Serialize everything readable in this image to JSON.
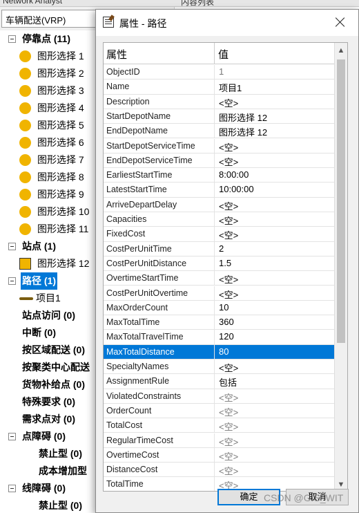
{
  "app": {
    "top_tab_left": "Network Analyst",
    "top_tab_right": "内容列表",
    "analysis_layer": "车辆配送(VRP)"
  },
  "tree": [
    {
      "label": "停靠点 (11)",
      "kind": "group",
      "bold": true
    },
    {
      "label": "图形选择 1",
      "kind": "stop"
    },
    {
      "label": "图形选择 2",
      "kind": "stop"
    },
    {
      "label": "图形选择 3",
      "kind": "stop"
    },
    {
      "label": "图形选择 4",
      "kind": "stop"
    },
    {
      "label": "图形选择 5",
      "kind": "stop"
    },
    {
      "label": "图形选择 6",
      "kind": "stop"
    },
    {
      "label": "图形选择 7",
      "kind": "stop"
    },
    {
      "label": "图形选择 8",
      "kind": "stop"
    },
    {
      "label": "图形选择 9",
      "kind": "stop"
    },
    {
      "label": "图形选择 10",
      "kind": "stop"
    },
    {
      "label": "图形选择 11",
      "kind": "stop"
    },
    {
      "label": "站点 (1)",
      "kind": "group",
      "bold": true
    },
    {
      "label": "图形选择 12",
      "kind": "depot"
    },
    {
      "label": "路径 (1)",
      "kind": "group",
      "bold": true,
      "selected": true
    },
    {
      "label": "项目1",
      "kind": "route"
    },
    {
      "label": "站点访问 (0)",
      "kind": "leaf",
      "bold": true
    },
    {
      "label": "中断 (0)",
      "kind": "leaf",
      "bold": true
    },
    {
      "label": "按区域配送 (0)",
      "kind": "leaf",
      "bold": true
    },
    {
      "label": "按聚类中心配送",
      "kind": "leaf",
      "bold": true
    },
    {
      "label": "货物补给点 (0)",
      "kind": "leaf",
      "bold": true
    },
    {
      "label": "特殊要求 (0)",
      "kind": "leaf",
      "bold": true
    },
    {
      "label": "需求点对 (0)",
      "kind": "leaf",
      "bold": true
    },
    {
      "label": "点障碍 (0)",
      "kind": "group",
      "bold": true
    },
    {
      "label": "禁止型 (0)",
      "kind": "subleaf",
      "bold": true
    },
    {
      "label": "成本增加型",
      "kind": "subleaf",
      "bold": true
    },
    {
      "label": "线障碍 (0)",
      "kind": "group",
      "bold": true
    },
    {
      "label": "禁止型 (0)",
      "kind": "subleaf",
      "bold": true
    }
  ],
  "dialog": {
    "title": "属性 - 路径",
    "header_property": "属性",
    "header_value": "值",
    "rows": [
      {
        "k": "ObjectID",
        "v": "1",
        "dim": true
      },
      {
        "k": "Name",
        "v": "项目1"
      },
      {
        "k": "Description",
        "v": "<空>"
      },
      {
        "k": "StartDepotName",
        "v": "图形选择 12"
      },
      {
        "k": "EndDepotName",
        "v": "图形选择 12"
      },
      {
        "k": "StartDepotServiceTime",
        "v": "<空>"
      },
      {
        "k": "EndDepotServiceTime",
        "v": "<空>"
      },
      {
        "k": "EarliestStartTime",
        "v": "8:00:00"
      },
      {
        "k": "LatestStartTime",
        "v": "10:00:00"
      },
      {
        "k": "ArriveDepartDelay",
        "v": "<空>"
      },
      {
        "k": "Capacities",
        "v": "<空>"
      },
      {
        "k": "FixedCost",
        "v": "<空>"
      },
      {
        "k": "CostPerUnitTime",
        "v": "2"
      },
      {
        "k": "CostPerUnitDistance",
        "v": "1.5"
      },
      {
        "k": "OvertimeStartTime",
        "v": "<空>"
      },
      {
        "k": "CostPerUnitOvertime",
        "v": "<空>"
      },
      {
        "k": "MaxOrderCount",
        "v": "10"
      },
      {
        "k": "MaxTotalTime",
        "v": "360"
      },
      {
        "k": "MaxTotalTravelTime",
        "v": "120"
      },
      {
        "k": "MaxTotalDistance",
        "v": "80",
        "selected": true
      },
      {
        "k": "SpecialtyNames",
        "v": "<空>"
      },
      {
        "k": "AssignmentRule",
        "v": "包括"
      },
      {
        "k": "ViolatedConstraints",
        "v": "<空>",
        "dim": true
      },
      {
        "k": "OrderCount",
        "v": "<空>",
        "dim": true
      },
      {
        "k": "TotalCost",
        "v": "<空>",
        "dim": true
      },
      {
        "k": "RegularTimeCost",
        "v": "<空>",
        "dim": true
      },
      {
        "k": "OvertimeCost",
        "v": "<空>",
        "dim": true
      },
      {
        "k": "DistanceCost",
        "v": "<空>",
        "dim": true
      },
      {
        "k": "TotalTime",
        "v": "<空>",
        "dim": true
      }
    ],
    "ok_label": "确定",
    "cancel_label": "取消"
  },
  "watermark": "CSDN @GIS_WIT",
  "colors": {
    "selection": "#0078d7",
    "symbol": "#f0b400"
  }
}
